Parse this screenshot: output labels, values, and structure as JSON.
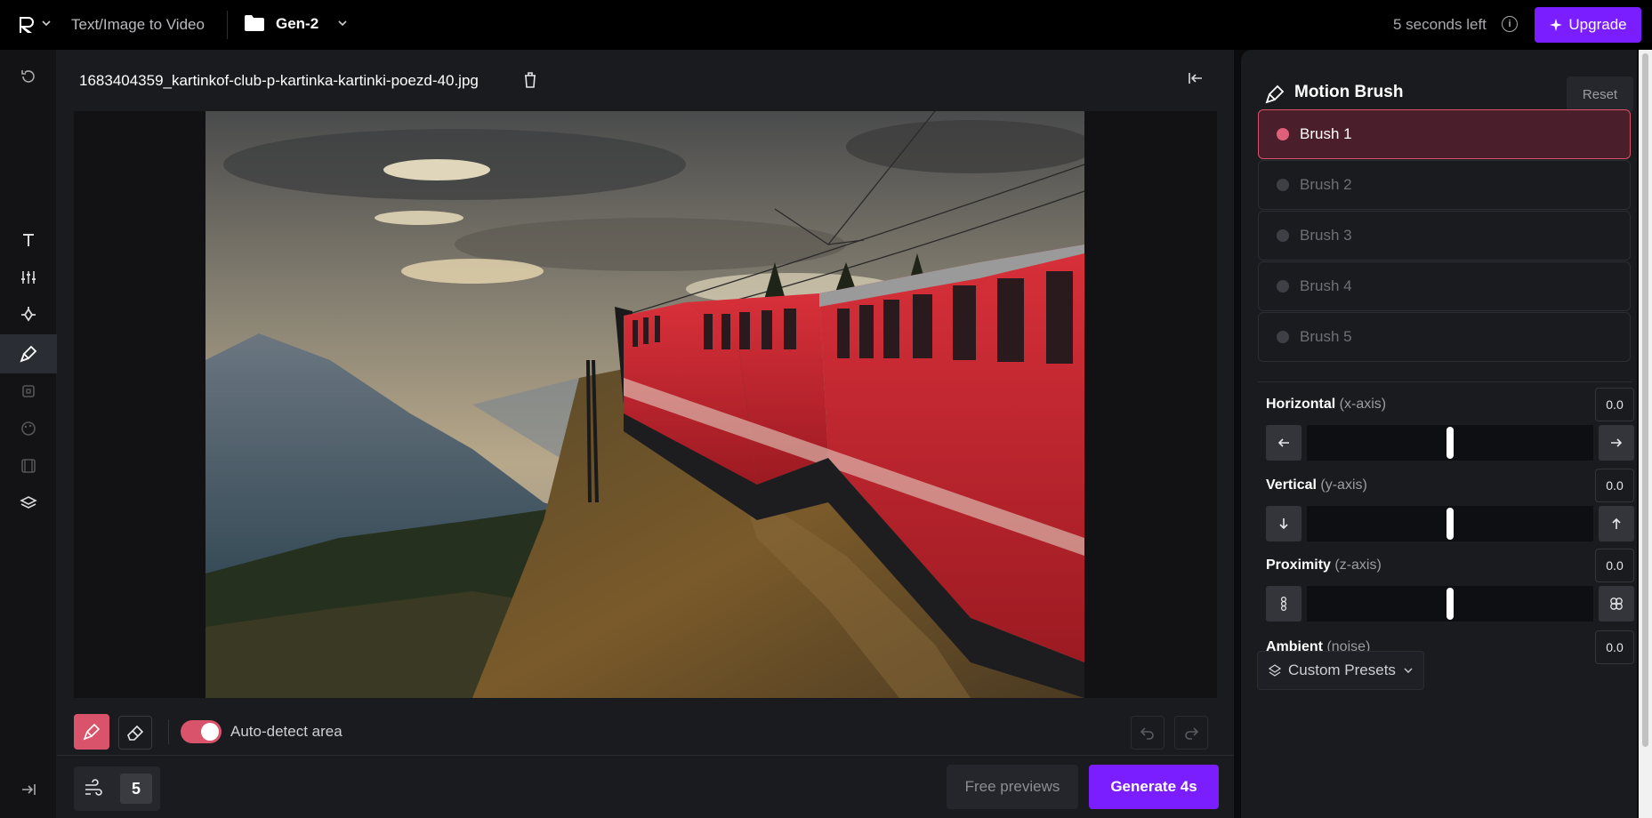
{
  "topbar": {
    "breadcrumb": "Text/Image to Video",
    "project": "Gen-2",
    "time_left": "5 seconds left",
    "upgrade_label": "Upgrade"
  },
  "rail": {
    "icons": [
      "undo-icon",
      "text-icon",
      "sliders-icon",
      "camera-motion-icon",
      "motion-brush-icon",
      "frame-icon",
      "palette-icon",
      "film-icon",
      "layers-icon",
      "expand-icon"
    ]
  },
  "editor": {
    "filename": "1683404359_kartinkof-club-p-kartinka-kartinki-poezd-40.jpg",
    "auto_detect_label": "Auto-detect area",
    "auto_detect_on": true
  },
  "bottom": {
    "motion_value": "5",
    "free_previews_label": "Free previews",
    "generate_label": "Generate 4s"
  },
  "motion_brush": {
    "title": "Motion Brush",
    "reset_label": "Reset",
    "brushes": [
      {
        "label": "Brush 1",
        "selected": true
      },
      {
        "label": "Brush 2",
        "selected": false
      },
      {
        "label": "Brush 3",
        "selected": false
      },
      {
        "label": "Brush 4",
        "selected": false
      },
      {
        "label": "Brush 5",
        "selected": false
      }
    ],
    "axes": [
      {
        "name": "Horizontal",
        "sub": "(x-axis)",
        "value": "0.0",
        "level": 0.5
      },
      {
        "name": "Vertical",
        "sub": "(y-axis)",
        "value": "0.0",
        "level": 0.5
      },
      {
        "name": "Proximity",
        "sub": "(z-axis)",
        "value": "0.0",
        "level": 0.5
      },
      {
        "name": "Ambient",
        "sub": "(noise)",
        "value": "0.0"
      }
    ],
    "presets_label": "Custom Presets"
  },
  "colors": {
    "accent_purple": "#7a1eff",
    "brush_red": "#d9536a"
  }
}
